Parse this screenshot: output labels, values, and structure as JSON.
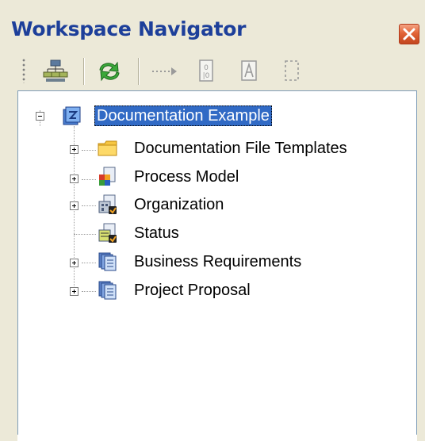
{
  "window": {
    "title": "Workspace Navigator"
  },
  "toolbar": {
    "buttons": [
      {
        "name": "hierarchy",
        "enabled": true
      },
      {
        "name": "refresh",
        "enabled": true
      },
      {
        "name": "link-arrow",
        "enabled": false
      },
      {
        "name": "properties",
        "enabled": false
      },
      {
        "name": "text",
        "enabled": false
      },
      {
        "name": "selection",
        "enabled": false
      }
    ]
  },
  "tree": {
    "root": {
      "label": "Documentation Example",
      "expanded": true,
      "selected": true
    },
    "items": [
      {
        "label": "Documentation File Templates",
        "icon": "folder-icon",
        "has_children": true
      },
      {
        "label": "Process Model",
        "icon": "process-model-icon",
        "has_children": true
      },
      {
        "label": "Organization",
        "icon": "organization-icon",
        "has_children": true
      },
      {
        "label": "Status",
        "icon": "status-icon",
        "has_children": false
      },
      {
        "label": "Business Requirements",
        "icon": "document-stack-icon",
        "has_children": true
      },
      {
        "label": "Project Proposal",
        "icon": "document-stack-icon",
        "has_children": true
      }
    ]
  },
  "colors": {
    "title": "#1d3f9a",
    "selection": "#316ac5",
    "close_button": "#e26437",
    "panel": "#ece9d8"
  }
}
